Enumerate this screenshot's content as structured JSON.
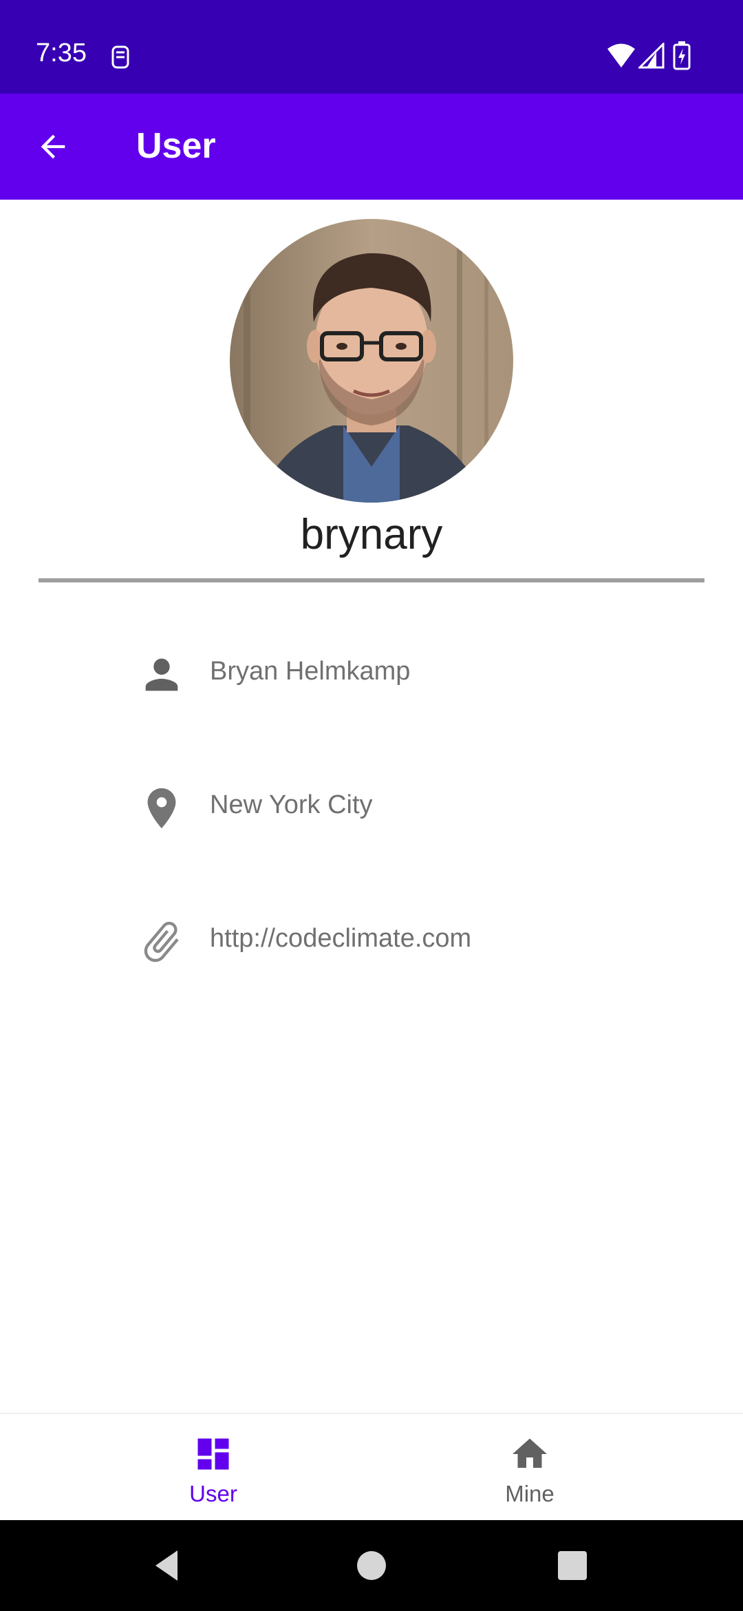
{
  "status_bar": {
    "time": "7:35",
    "icons": [
      "sim-icon",
      "wifi-icon",
      "signal-icon",
      "battery-charging-icon"
    ]
  },
  "app_bar": {
    "title": "User",
    "back_icon": "arrow-back-icon"
  },
  "profile": {
    "username": "brynary",
    "info": [
      {
        "icon": "person-icon",
        "text": "Bryan Helmkamp"
      },
      {
        "icon": "location-pin-icon",
        "text": "New York City"
      },
      {
        "icon": "paperclip-icon",
        "text": "http://codeclimate.com"
      }
    ]
  },
  "bottom_nav": {
    "items": [
      {
        "label": "User",
        "icon": "dashboard-icon",
        "selected": true
      },
      {
        "label": "Mine",
        "icon": "home-icon",
        "selected": false
      }
    ]
  },
  "colors": {
    "status_bar": "#3700b3",
    "app_bar": "#6200ee",
    "accent": "#6200ee",
    "secondary_text": "#707070",
    "icon_gray": "#616161",
    "divider": "#9e9e9e"
  }
}
